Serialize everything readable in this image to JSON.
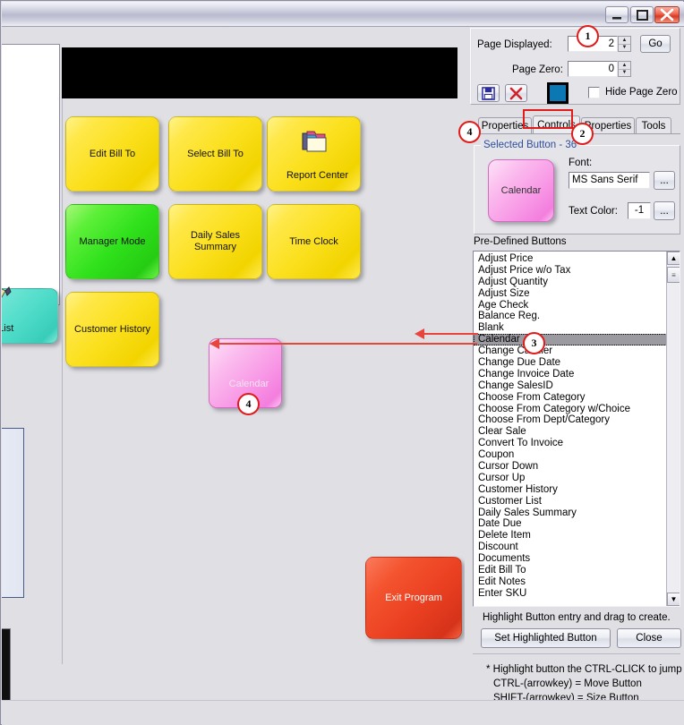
{
  "window": {
    "title": "",
    "controls": {
      "minimize": "minimize-icon",
      "maximize": "maximize-icon",
      "close": "close-icon"
    }
  },
  "pos": {
    "buttons": [
      {
        "label": "Edit Bill To",
        "color": "yellow",
        "icon": ""
      },
      {
        "label": "Select Bill To",
        "color": "yellow",
        "icon": ""
      },
      {
        "label": "Report Center",
        "color": "yellow",
        "icon": "folders-icon"
      },
      {
        "label": "Manager Mode",
        "color": "green",
        "icon": ""
      },
      {
        "label": "Daily Sales\nSummary",
        "color": "yellow",
        "icon": ""
      },
      {
        "label": "Time Clock",
        "color": "yellow",
        "icon": ""
      },
      {
        "label": "Customer History",
        "color": "yellow",
        "icon": ""
      }
    ],
    "daily_sales_line1": "Daily Sales",
    "daily_sales_line2": "Summary",
    "new_button": {
      "label": "Calendar",
      "color": "pink"
    },
    "exit_button": {
      "label": "Exit Program",
      "color": "red"
    },
    "background_button": {
      "label": "tomer List",
      "color": "teal",
      "icon": "pencil-icon"
    }
  },
  "panel": {
    "page_displayed": {
      "label": "Page Displayed:",
      "value": "2"
    },
    "page_zero": {
      "label": "Page Zero:",
      "value": "0"
    },
    "go_button": "Go",
    "save_icon": "floppy-save-icon",
    "cancel_icon": "red-x-cancel-icon",
    "color_swatch": "#0b78b4",
    "hide_page_zero": {
      "label": "Hide Page Zero",
      "checked": false
    },
    "tabs": [
      {
        "label": "Properties",
        "active": false
      },
      {
        "label": "Controls",
        "active": true
      },
      {
        "label": "Properties",
        "active": false
      },
      {
        "label": "Tools",
        "active": false
      }
    ],
    "selected_button_group": {
      "caption": "Selected Button - 36",
      "preview_label": "Calendar",
      "font_label": "Font:",
      "font_value": "MS Sans Serif",
      "font_browse": "...",
      "text_color_label": "Text Color:",
      "text_color_value": "-1",
      "text_color_browse": "..."
    },
    "predefined_caption": "Pre-Defined Buttons",
    "predefined_items": [
      "Adjust Price",
      "Adjust Price w/o Tax",
      "Adjust Quantity",
      "Adjust Size",
      "Age Check",
      "Balance Reg.",
      "Blank",
      "Calendar",
      "Change Cashier",
      "Change Due Date",
      "Change Invoice Date",
      "Change SalesID",
      "Choose From Category",
      "Choose From Category w/Choice",
      "Choose From Dept/Category",
      "Clear Sale",
      "Convert To Invoice",
      "Coupon",
      "Cursor Down",
      "Cursor Up",
      "Customer History",
      "Customer List",
      "Daily Sales Summary",
      "Date Due",
      "Delete Item",
      "Discount",
      "Documents",
      "Edit Bill To",
      "Edit Notes",
      "Enter SKU"
    ],
    "selected_item": "Calendar",
    "hint_text": "Highlight Button entry and drag to create.",
    "set_highlighted_button": "Set Highlighted Button",
    "close_button": "Close",
    "footnotes": [
      "* Highlight button the CTRL-CLICK to jump",
      "CTRL-(arrowkey) = Move Button",
      "SHIFT-(arrowkey) = Size Button"
    ]
  },
  "annotations": {
    "marker_1": "1",
    "marker_2": "2",
    "marker_3": "3",
    "marker_4a": "4",
    "marker_4b": "4",
    "highlight_color": "#e01b1b",
    "arrow_color": "#e8453c"
  }
}
